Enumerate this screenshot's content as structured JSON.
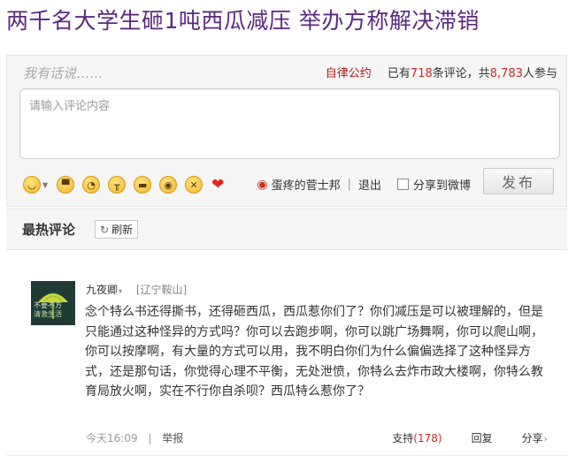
{
  "headline": "两千名大学生砸1吨西瓜减压 举办方称解决滞销",
  "comment_box": {
    "title": "我有话说……",
    "rules_link": "自律公约",
    "stats_prefix": "已有",
    "comment_count": "718",
    "stats_middle": "条评论，共",
    "participant_count": "8,783",
    "stats_suffix": "人参与",
    "textarea_placeholder": "请输入评论内容",
    "emoji_icons": [
      "smile-emoji",
      "laugh-emoji",
      "shy-emoji",
      "cry-emoji",
      "grin-emoji",
      "wow-emoji",
      "dizzy-emoji",
      "heart-emoji"
    ],
    "account_name": "蛋疼的菅士邦",
    "logout_label": "退出",
    "share_label": "分享到微博",
    "post_label": "发布"
  },
  "hot_section": {
    "title": "最热评论",
    "refresh_label": "刷新"
  },
  "comment": {
    "avatar_line1": "不要不方",
    "avatar_line2": "清激生活",
    "username": "九夜卿",
    "location": "[辽宁鞍山]",
    "content": "念个特么书还得撕书，还得砸西瓜，西瓜惹你们了？你们减压是可以被理解的，但是只能通过这种怪异的方式吗？你可以去跑步啊，你可以跳广场舞啊，你可以爬山啊，你可以按摩啊，有大量的方式可以用，我不明白你们为什么偏偏选择了这种怪异方式，还是那句话，你觉得心理不平衡，无处泄愤，你特么去炸市政大楼啊，你特么教育局放火啊，实在不行你自杀呗？西瓜特么惹你了？",
    "time": "今天16:09",
    "report_label": "举报",
    "support_label": "支持",
    "support_count": "(178)",
    "reply_label": "回复",
    "share_label": "分享"
  },
  "colors": {
    "headline": "#5b2a7e",
    "count_red": "#c62a2a",
    "panel_bg": "#f6f6f6"
  }
}
